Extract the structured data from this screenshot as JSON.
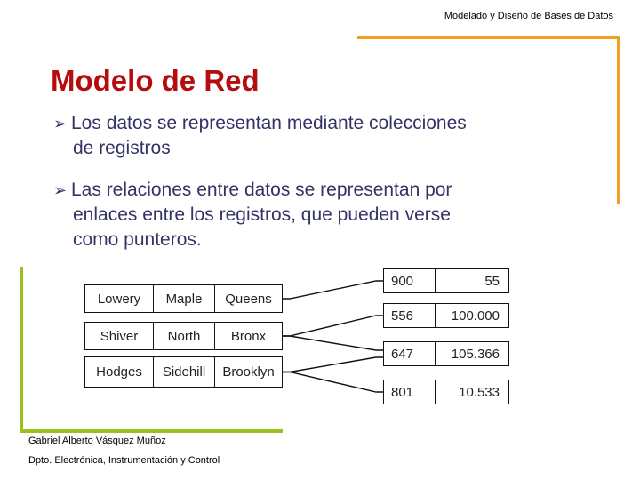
{
  "header": {
    "course_title": "Modelado y Diseño de Bases de Datos"
  },
  "colors": {
    "accent_orange": "#f0a01e",
    "accent_green": "#99c21c",
    "title": "#b50d0d",
    "body": "#333366"
  },
  "slide": {
    "title": "Modelo de Red",
    "bullets": [
      {
        "icon": "arrow-bullet-icon",
        "lines": [
          "Los datos se representan mediante colecciones",
          "de registros"
        ]
      },
      {
        "icon": "arrow-bullet-icon",
        "lines": [
          "Las relaciones entre datos se representan por",
          "enlaces entre los registros, que pueden verse",
          "como punteros."
        ]
      }
    ]
  },
  "diagram": {
    "customers": [
      [
        "Lowery",
        "Maple",
        "Queens"
      ],
      [
        "Shiver",
        "North",
        "Bronx"
      ],
      [
        "Hodges",
        "Sidehill",
        "Brooklyn"
      ]
    ],
    "accounts": [
      [
        "900",
        "55"
      ],
      [
        "556",
        "100.000"
      ],
      [
        "647",
        "105.366"
      ],
      [
        "801",
        "10.533"
      ]
    ],
    "links": [
      {
        "from": "Lowery",
        "to": "900"
      },
      {
        "from": "Shiver",
        "to": "556"
      },
      {
        "from": "Shiver",
        "to": "647"
      },
      {
        "from": "Hodges",
        "to": "647"
      },
      {
        "from": "Hodges",
        "to": "801"
      }
    ]
  },
  "footer": {
    "author": "Gabriel Alberto Vásquez Muñoz",
    "department": "Dpto. Electrónica, Instrumentación y Control"
  }
}
